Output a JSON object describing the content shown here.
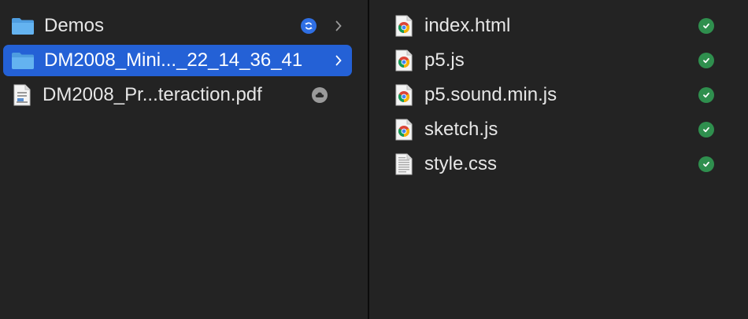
{
  "left_column": {
    "items": [
      {
        "name": "Demos",
        "type": "folder",
        "status": "sync-icon",
        "has_children": true,
        "selected": false
      },
      {
        "name": "DM2008_Mini..._22_14_36_41",
        "type": "folder",
        "status": "",
        "has_children": true,
        "selected": true
      },
      {
        "name": "DM2008_Pr...teraction.pdf",
        "type": "pdf",
        "status": "cloud-icon",
        "has_children": false,
        "selected": false
      }
    ]
  },
  "right_column": {
    "items": [
      {
        "name": "index.html",
        "type": "chrome-doc",
        "status": "synced-check-icon"
      },
      {
        "name": "p5.js",
        "type": "chrome-doc",
        "status": "synced-check-icon"
      },
      {
        "name": "p5.sound.min.js",
        "type": "chrome-doc",
        "status": "synced-check-icon"
      },
      {
        "name": "sketch.js",
        "type": "chrome-doc",
        "status": "synced-check-icon"
      },
      {
        "name": "style.css",
        "type": "text-doc",
        "status": "synced-check-icon"
      }
    ]
  },
  "colors": {
    "selection": "#2461d6",
    "folder": "#58a8e8",
    "sync_badge": "#2f6fe4",
    "check_badge": "#2f8f4e",
    "cloud_badge": "#9a9a9a"
  }
}
